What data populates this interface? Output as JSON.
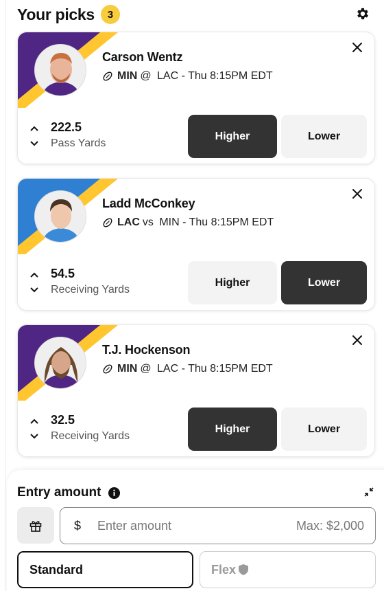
{
  "header": {
    "title": "Your picks",
    "count": "3"
  },
  "picks": [
    {
      "player": "Carson Wentz",
      "team": "MIN",
      "connector": "@",
      "opponent": "LAC",
      "game_time": "Thu 8:15PM EDT",
      "line": "222.5",
      "stat": "Pass Yards",
      "higher_label": "Higher",
      "lower_label": "Lower",
      "selected": "higher",
      "banner_color": "#4f2683",
      "stripe_color": "#ffc62f"
    },
    {
      "player": "Ladd McConkey",
      "team": "LAC",
      "connector": "vs",
      "opponent": "MIN",
      "game_time": "Thu 8:15PM EDT",
      "line": "54.5",
      "stat": "Receiving Yards",
      "higher_label": "Higher",
      "lower_label": "Lower",
      "selected": "lower",
      "banner_color": "#2f7fd2",
      "stripe_color": "#ffc62f"
    },
    {
      "player": "T.J. Hockenson",
      "team": "MIN",
      "connector": "@",
      "opponent": "LAC",
      "game_time": "Thu 8:15PM EDT",
      "line": "32.5",
      "stat": "Receiving Yards",
      "higher_label": "Higher",
      "lower_label": "Lower",
      "selected": "higher",
      "banner_color": "#4f2683",
      "stripe_color": "#ffc62f"
    }
  ],
  "entry": {
    "title": "Entry amount",
    "currency": "$",
    "placeholder": "Enter amount",
    "max": "Max: $2,000",
    "standard_label": "Standard",
    "flex_label": "Flex"
  },
  "colors": {
    "badge": "#f7cc3d",
    "selected_button": "#333333",
    "unselected_button": "#f3f3f3"
  }
}
